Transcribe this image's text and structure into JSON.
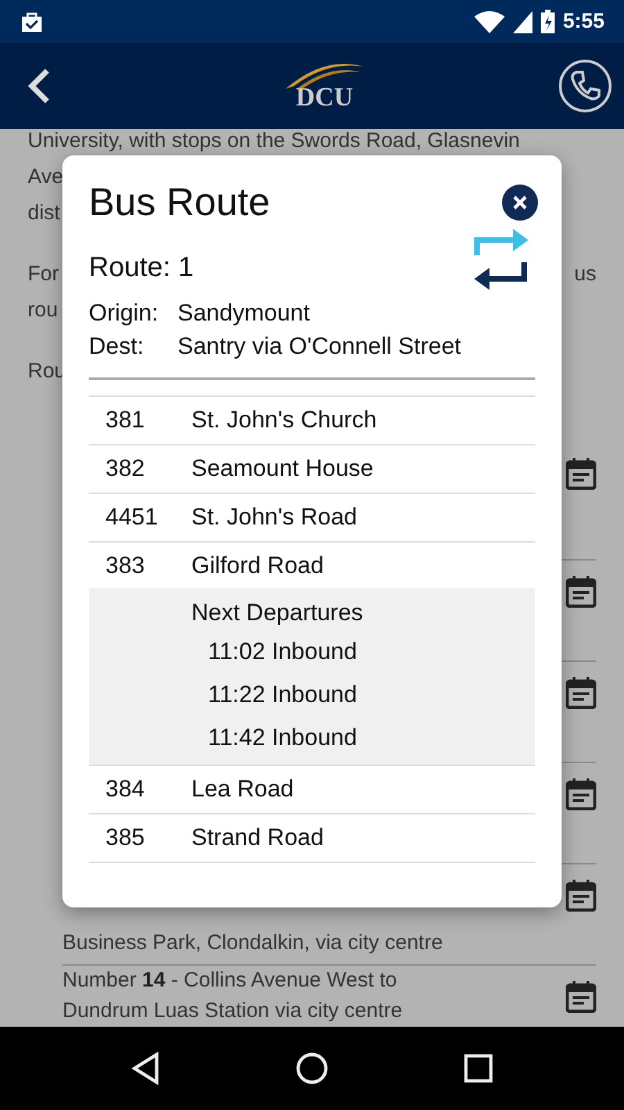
{
  "status_bar": {
    "time": "5:55"
  },
  "header": {
    "logo": "DCU"
  },
  "background": {
    "paragraphs": [
      {
        "lines": [
          {
            "left": "University, with stops on the Swords Road, Glasnevin"
          },
          {
            "left": "Ave"
          },
          {
            "left": "dist"
          }
        ]
      },
      {
        "lines": [
          {
            "left": "For",
            "right": "us"
          },
          {
            "left": "rou"
          }
        ]
      },
      {
        "lines": [
          {
            "left": "Rou"
          }
        ]
      }
    ],
    "routes": [
      {
        "kind": "covered"
      },
      {
        "kind": "covered"
      },
      {
        "kind": "covered"
      },
      {
        "kind": "covered"
      },
      {
        "kind": "text",
        "lines": [
          "Business Park, Clondalkin, via city centre"
        ]
      },
      {
        "kind": "text",
        "lines": [
          "Number **14** - Collins Avenue West to",
          "Dundrum Luas Station via city centre"
        ]
      }
    ]
  },
  "dialog": {
    "title": "Bus Route",
    "route": "Route: 1",
    "origin_label": "Origin:",
    "origin": "Sandymount",
    "dest_label": "Dest:",
    "dest": "Santry via O'Connell Street",
    "stops": [
      {
        "code": "381",
        "name": "St. John's Church",
        "expanded": false
      },
      {
        "code": "382",
        "name": "Seamount House",
        "expanded": false
      },
      {
        "code": "4451",
        "name": "St. John's Road",
        "expanded": false
      },
      {
        "code": "383",
        "name": "Gilford Road",
        "expanded": true,
        "departures": {
          "title": "Next Departures",
          "times": [
            "11:02 Inbound",
            "11:22 Inbound",
            "11:42 Inbound"
          ]
        }
      },
      {
        "code": "384",
        "name": "Lea Road",
        "expanded": false
      },
      {
        "code": "385",
        "name": "Strand Road",
        "expanded": false
      }
    ]
  }
}
